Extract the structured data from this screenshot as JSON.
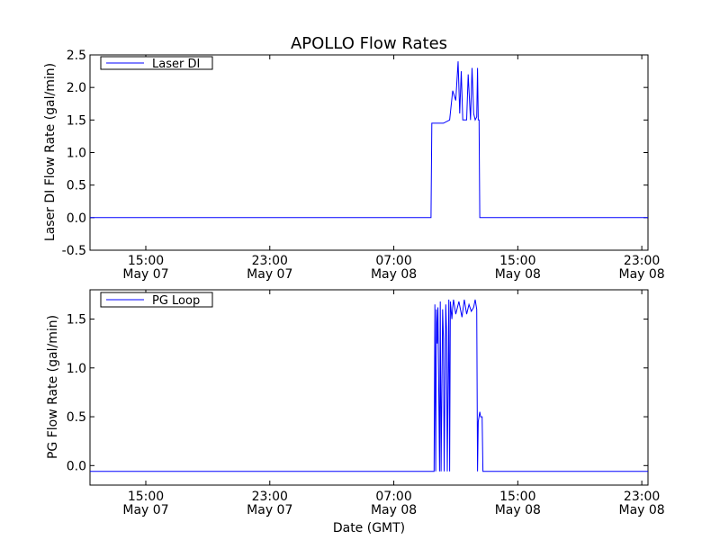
{
  "chart_data": [
    {
      "type": "line",
      "title": "APOLLO Flow Rates",
      "xlabel": "",
      "ylabel": "Laser DI Flow Rate (gal/min)",
      "ylim": [
        -0.5,
        2.5
      ],
      "xlim_hours": [
        0,
        36
      ],
      "yticks": [
        "-0.5",
        "0.0",
        "0.5",
        "1.0",
        "1.5",
        "2.0",
        "2.5"
      ],
      "xticks": [
        {
          "time": "15:00",
          "date": "May 07"
        },
        {
          "time": "23:00",
          "date": "May 07"
        },
        {
          "time": "07:00",
          "date": "May 08"
        },
        {
          "time": "15:00",
          "date": "May 08"
        },
        {
          "time": "23:00",
          "date": "May 08"
        }
      ],
      "legend": {
        "label": "Laser DI",
        "placement": "top-left"
      },
      "color": "#0000ff",
      "grid": false,
      "series": [
        {
          "name": "Laser DI",
          "x": [
            0,
            22,
            22.05,
            22.2,
            22.8,
            23.2,
            23.4,
            23.6,
            23.75,
            23.85,
            23.95,
            24.05,
            24.2,
            24.3,
            24.4,
            24.55,
            24.65,
            24.75,
            24.85,
            24.95,
            25.0,
            25.05,
            25.1,
            25.15,
            36
          ],
          "y": [
            0.0,
            0.0,
            1.45,
            1.45,
            1.45,
            1.5,
            1.95,
            1.8,
            2.4,
            1.6,
            2.25,
            1.5,
            1.5,
            1.5,
            2.2,
            1.5,
            2.3,
            1.6,
            1.5,
            1.55,
            2.3,
            1.5,
            1.5,
            0.0,
            0.0
          ]
        }
      ]
    },
    {
      "type": "line",
      "title": "",
      "xlabel": "Date (GMT)",
      "ylabel": "PG Flow Rate (gal/min)",
      "ylim": [
        -0.2,
        1.8
      ],
      "xlim_hours": [
        0,
        36
      ],
      "yticks": [
        "0.0",
        "0.5",
        "1.0",
        "1.5"
      ],
      "xticks": [
        {
          "time": "15:00",
          "date": "May 07"
        },
        {
          "time": "23:00",
          "date": "May 07"
        },
        {
          "time": "07:00",
          "date": "May 08"
        },
        {
          "time": "15:00",
          "date": "May 08"
        },
        {
          "time": "23:00",
          "date": "May 08"
        }
      ],
      "legend": {
        "label": "PG Loop",
        "placement": "top-left"
      },
      "color": "#0000ff",
      "grid": false,
      "series": [
        {
          "name": "PG Loop",
          "x": [
            0,
            22.2,
            22.25,
            22.3,
            22.35,
            22.4,
            22.45,
            22.55,
            22.6,
            22.65,
            22.75,
            22.8,
            22.85,
            22.95,
            23.0,
            23.05,
            23.15,
            23.2,
            23.25,
            23.35,
            23.4,
            23.45,
            23.6,
            23.8,
            24.0,
            24.15,
            24.3,
            24.45,
            24.6,
            24.75,
            24.85,
            24.95,
            25.0,
            25.05,
            25.15,
            25.2,
            25.3,
            25.35,
            36
          ],
          "y": [
            -0.06,
            -0.06,
            1.65,
            -0.06,
            1.6,
            1.25,
            1.62,
            -0.06,
            1.68,
            -0.06,
            1.6,
            1.3,
            -0.06,
            1.65,
            1.4,
            -0.06,
            1.7,
            -0.06,
            1.68,
            1.5,
            1.62,
            1.7,
            1.55,
            1.68,
            1.52,
            1.7,
            1.55,
            1.65,
            1.58,
            1.62,
            1.7,
            1.6,
            -0.06,
            0.45,
            0.55,
            0.5,
            0.5,
            -0.06,
            -0.06
          ]
        }
      ]
    }
  ]
}
